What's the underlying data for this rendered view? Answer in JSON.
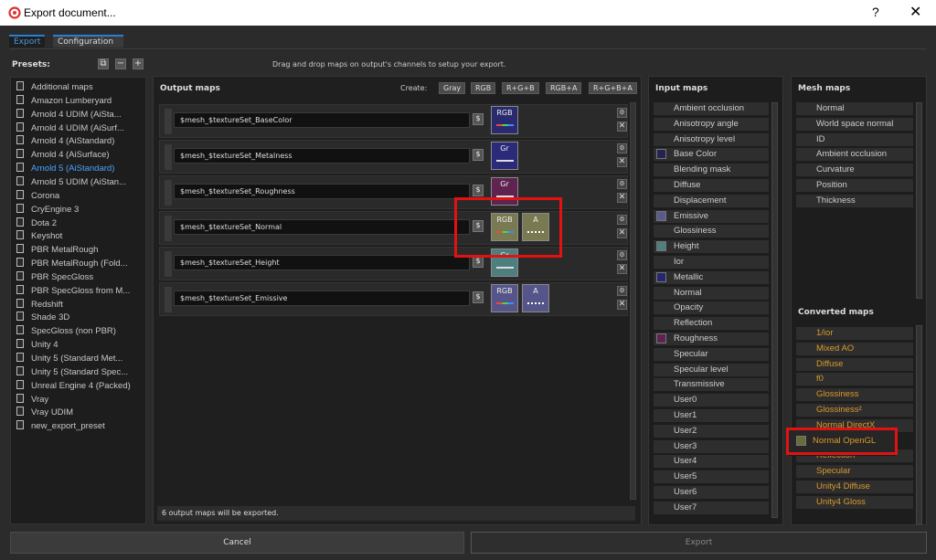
{
  "window": {
    "title": "Export document...",
    "help": "?",
    "close": "✕"
  },
  "tabs": [
    "Export",
    "Configuration"
  ],
  "presets": {
    "label": "Presets:",
    "items": [
      "Additional maps",
      "Amazon Lumberyard",
      "Arnold 4  UDIM (AiSta...",
      "Arnold 4  UDIM (AiSurf...",
      "Arnold 4 (AiStandard)",
      "Arnold 4 (AiSurface)",
      "Arnold 5 (AiStandard)",
      "Arnold 5 UDIM (AiStan...",
      "Corona",
      "CryEngine 3",
      "Dota 2",
      "Keyshot",
      "PBR MetalRough",
      "PBR MetalRough (Fold...",
      "PBR SpecGloss",
      "PBR SpecGloss from M...",
      "Redshift",
      "Shade 3D",
      "SpecGloss (non PBR)",
      "Unity 4",
      "Unity 5 (Standard Met...",
      "Unity 5 (Standard Spec...",
      "Unreal Engine 4 (Packed)",
      "Vray",
      "Vray UDIM",
      "new_export_preset"
    ],
    "selected_index": 6
  },
  "hint": "Drag and drop maps on output's channels to setup your export.",
  "output": {
    "title": "Output maps",
    "create_label": "Create:",
    "create_buttons": [
      "Gray",
      "RGB",
      "R+G+B",
      "RGB+A",
      "R+G+B+A"
    ],
    "rows": [
      {
        "name": "$mesh_$textureSet_BaseColor",
        "channels": [
          {
            "label": "RGB",
            "color": "#2a2a6e",
            "bar": "rgb"
          }
        ]
      },
      {
        "name": "$mesh_$textureSet_Metalness",
        "channels": [
          {
            "label": "Gr",
            "color": "#2a2a7a",
            "bar": "gray"
          }
        ]
      },
      {
        "name": "$mesh_$textureSet_Roughness",
        "channels": [
          {
            "label": "Gr",
            "color": "#5e2350",
            "bar": "gray"
          }
        ]
      },
      {
        "name": "$mesh_$textureSet_Normal",
        "channels": [
          {
            "label": "RGB",
            "color": "#7a7a52",
            "bar": "rgb"
          },
          {
            "label": "A",
            "color": "#7a7a52",
            "bar": "dots"
          }
        ]
      },
      {
        "name": "$mesh_$textureSet_Height",
        "channels": [
          {
            "label": "Gr",
            "color": "#4e7e7e",
            "bar": "gray"
          }
        ]
      },
      {
        "name": "$mesh_$textureSet_Emissive",
        "channels": [
          {
            "label": "RGB",
            "color": "#55558a",
            "bar": "rgb"
          },
          {
            "label": "A",
            "color": "#55558a",
            "bar": "dots"
          }
        ]
      }
    ],
    "dollar": "$",
    "gear": "⚙",
    "remove": "✕",
    "status": "6 output maps will be exported."
  },
  "input": {
    "title": "Input maps",
    "items": [
      {
        "label": "Ambient occlusion"
      },
      {
        "label": "Anisotropy angle"
      },
      {
        "label": "Anisotropy level"
      },
      {
        "label": "Base Color",
        "swatch": "#23234e"
      },
      {
        "label": "Blending mask"
      },
      {
        "label": "Diffuse"
      },
      {
        "label": "Displacement"
      },
      {
        "label": "Emissive",
        "swatch": "#5a5a8c"
      },
      {
        "label": "Glossiness"
      },
      {
        "label": "Height",
        "swatch": "#4e7e7e"
      },
      {
        "label": "Ior"
      },
      {
        "label": "Metallic",
        "swatch": "#26266e"
      },
      {
        "label": "Normal"
      },
      {
        "label": "Opacity"
      },
      {
        "label": "Reflection"
      },
      {
        "label": "Roughness",
        "swatch": "#5e2350"
      },
      {
        "label": "Specular"
      },
      {
        "label": "Specular level"
      },
      {
        "label": "Transmissive"
      },
      {
        "label": "User0"
      },
      {
        "label": "User1"
      },
      {
        "label": "User2"
      },
      {
        "label": "User3"
      },
      {
        "label": "User4"
      },
      {
        "label": "User5"
      },
      {
        "label": "User6"
      },
      {
        "label": "User7"
      }
    ]
  },
  "mesh": {
    "title": "Mesh maps",
    "items": [
      "Normal",
      "World space normal",
      "ID",
      "Ambient occlusion",
      "Curvature",
      "Position",
      "Thickness"
    ]
  },
  "converted": {
    "title": "Converted maps",
    "items": [
      "1/ior",
      "Mixed AO",
      "Diffuse",
      "f0",
      "Glossiness",
      "Glossiness²",
      "Normal DirectX",
      "Normal OpenGL",
      "Reflection",
      "Specular",
      "Unity4 Diffuse",
      "Unity4 Gloss"
    ],
    "highlight_index": 7,
    "highlight_swatch": "#6b6b3a",
    "text_color": "#d99a2b"
  },
  "buttons": {
    "cancel": "Cancel",
    "export": "Export"
  },
  "colors": {
    "accent": "#2a7fd4",
    "highlight": "#e31212"
  }
}
